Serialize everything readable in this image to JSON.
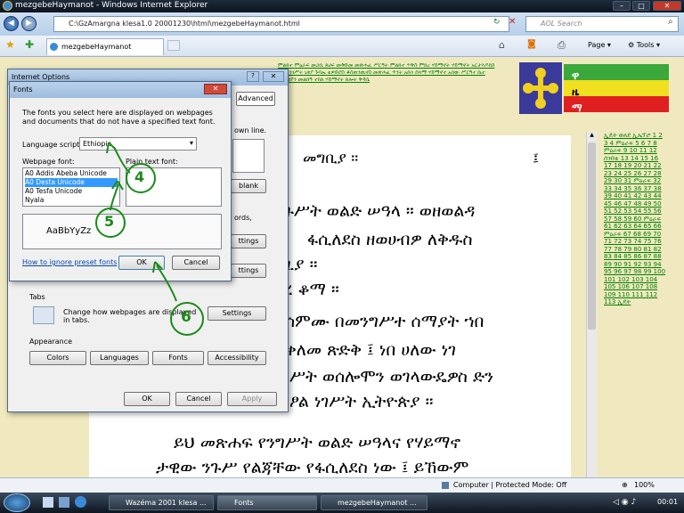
{
  "window": {
    "title": "mezgebeHaymanot - Windows Internet Explorer",
    "min": "–",
    "max": "□",
    "close": "✕"
  },
  "address": {
    "url": "C:\\GzAmargna klesa1.0 20001230\\html\\mezgebeHaymanot.html",
    "search_placeholder": "AOL Search"
  },
  "tab": {
    "label": "mezgebeHaymanot"
  },
  "toolbar": {
    "page": "Page",
    "tools": "Tools"
  },
  "page": {
    "top_links": "ምልክተ ምዕራፍ  መጋቢ ጸሀፍ  መቅድመ  መጽሐፈ ሥርዓት  ምልክተ ጥቅስ  ምክረ ሃይማኖት  ሃይማኖት አርታእዶክስ  ታሪከ ነገሥት  ኒቂያ ጉባኤ  ቴዎድሮስ  ቆስጠንጢኖስ  መጽሐፈ ጥንት  አቡነ ሰላማ  ሃይማኖተ አበው  ሥርዓተ ቤተ ክርስቲያን  መልክዓ  ተክለ ሃይማኖት  ጸሎት  ቅዳሴ",
    "flag_chars": [
      "ዋ",
      "ዜ",
      "ማ"
    ],
    "heading": "መግቢያ ።",
    "heading_mark": "፤",
    "lines": [
      "ጉሥት ወልድ ሠዓላ ። ወዘወልዳ",
      "ፋሲለደስ ዘወሀብዎ ለቅዱስ",
      "ጊያ ።",
      "ረ ቆማ ።",
      "ሰምሙ በመንግሥተ ሰማያት ኀበ",
      "ቀለመ ጽድቅ ፤ ነበ ሀለው ነገ",
      "ሥት ወሰሎሞን ወገላውዴዎስ ድን",
      "ፆል ነገሥት ኢትዮጵያ ።",
      "ይህ መጽሐፍ የንግሥት ወልድ ሠዓላና የሃይማኖ",
      "ታዊው ንጉሥ የልጃቸው የፋሲለደስ ነው ፤ ይኸውም"
    ],
    "right_links": "ኢዴት ወለደ ኢኤፕሮ 1 2 3 4 ምዕራፍ 5 6 7 8 ምዕራፍ 9 10 11 12 ሰንበቴ 13 14 15 16 17 18 19 20 21 22 23 24 25 26 27 28 29 30 31 ምዕራፍ 32 33 34 35 36 37 38 39 40 41 42 43 44 45 46 47 48 49 50 51 52 53 54 55 56 57 58 59 60 ምዕራፍ 61 62 63 64 65 66 ምዕራፍ 67 68 69 70 71 72 73 74 75 76 77 78 79 80 81 82 83 84 85 86 87 88 89 90 91 92 93 94 95 96 97 98 99 100 101 102 103 104 105 106 107 108 109 110 111 112 113 ኢዴት"
  },
  "internet_options": {
    "title": "Internet Options",
    "tab_advanced": "Advanced",
    "text_own_line": "own line.",
    "use_blank": "blank",
    "words_hint": "ords,",
    "settings_label": "ttings",
    "tabs_section": "Tabs",
    "tabs_desc": "Change how webpages are displayed in tabs.",
    "tabs_settings": "Settings",
    "appearance_section": "Appearance",
    "colors": "Colors",
    "languages": "Languages",
    "fonts": "Fonts",
    "accessibility": "Accessibility",
    "ok": "OK",
    "cancel": "Cancel",
    "apply": "Apply"
  },
  "fonts_dialog": {
    "title": "Fonts",
    "description": "The fonts you select here are displayed on webpages and documents that do not have a specified text font.",
    "language_label": "Language script:",
    "language_value": "Ethiopic",
    "webfont_label": "Webpage font:",
    "plaintext_label": "Plain text font:",
    "fonts": [
      "A0 Addis Abeba Unicode",
      "A0 Desta Unicode",
      "A0 Tesfa Unicode",
      "Nyala"
    ],
    "selected_index": 1,
    "preview": "AaBbYyZz",
    "link": "How to ignore preset fonts",
    "ok": "OK",
    "cancel": "Cancel",
    "close": "✕"
  },
  "annotations": [
    "4",
    "5",
    "6"
  ],
  "status": {
    "protected": "Computer | Protected Mode: Off",
    "zoom": "100%"
  },
  "taskbar": {
    "items": [
      "Wazéma 2001 klesa ...",
      "Fonts",
      "mezgebeHaymanot ..."
    ],
    "clock": "00:01"
  },
  "colors": {
    "accent": "#1a8a1a",
    "link": "#008000",
    "flag_green": "#3aa83a",
    "flag_yellow": "#f0e020",
    "flag_red": "#e02020",
    "emblem_blue": "#3a3a9a"
  }
}
